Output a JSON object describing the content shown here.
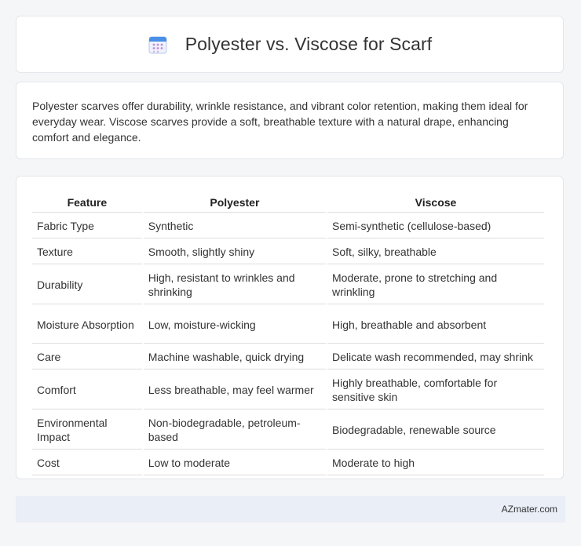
{
  "header": {
    "title": "Polyester vs. Viscose for Scarf",
    "icon": "calendar-icon"
  },
  "intro": {
    "text": "Polyester scarves offer durability, wrinkle resistance, and vibrant color retention, making them ideal for everyday wear. Viscose scarves provide a soft, breathable texture with a natural drape, enhancing comfort and elegance."
  },
  "table": {
    "headers": [
      "Feature",
      "Polyester",
      "Viscose"
    ],
    "rows": [
      [
        "Fabric Type",
        "Synthetic",
        "Semi-synthetic (cellulose-based)"
      ],
      [
        "Texture",
        "Smooth, slightly shiny",
        "Soft, silky, breathable"
      ],
      [
        "Durability",
        "High, resistant to wrinkles and shrinking",
        "Moderate, prone to stretching and wrinkling"
      ],
      [
        "Moisture Absorption",
        "Low, moisture-wicking",
        "High, breathable and absorbent"
      ],
      [
        "Care",
        "Machine washable, quick drying",
        "Delicate wash recommended, may shrink"
      ],
      [
        "Comfort",
        "Less breathable, may feel warmer",
        "Highly breathable, comfortable for sensitive skin"
      ],
      [
        "Environmental Impact",
        "Non-biodegradable, petroleum-based",
        "Biodegradable, renewable source"
      ],
      [
        "Cost",
        "Low to moderate",
        "Moderate to high"
      ]
    ]
  },
  "footer": {
    "text": "AZmater.com"
  },
  "colors": {
    "background": "#f5f6f8",
    "card": "#ffffff",
    "footer_bg": "#e9eef7",
    "icon_blue": "#4a8fe7",
    "icon_grid": "#c58ad9"
  }
}
